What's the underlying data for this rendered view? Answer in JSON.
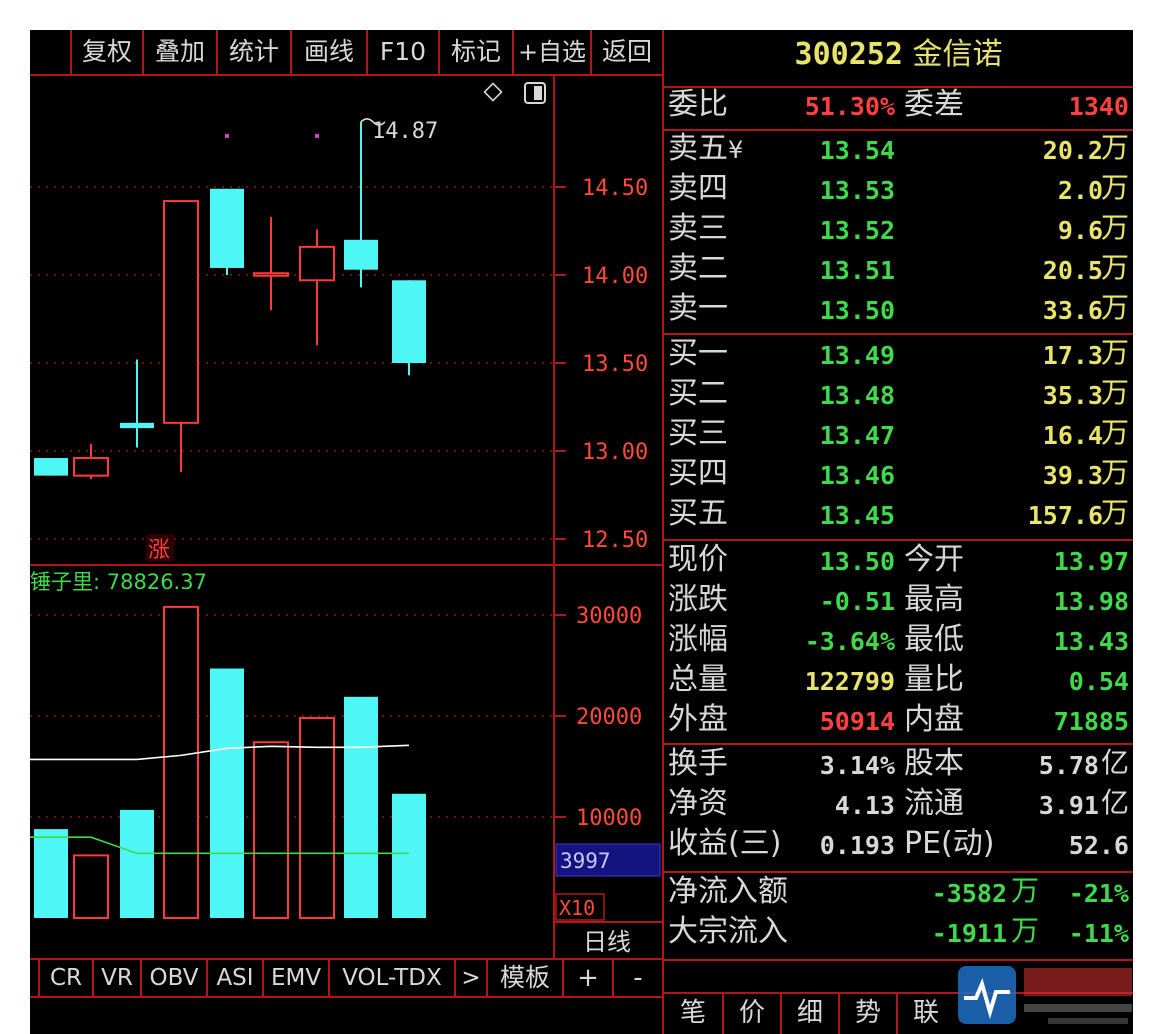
{
  "toolbar": {
    "buttons": [
      "复权",
      "叠加",
      "统计",
      "画线",
      "F10",
      "标记",
      "+自选",
      "返回"
    ]
  },
  "stock": {
    "code": "300252",
    "name": "金信诺"
  },
  "weibi": {
    "label": "委比",
    "value": "51.30%",
    "diff_label": "委差",
    "diff_value": "1340"
  },
  "sell_orders": [
    {
      "label": "卖五",
      "mark": "¥",
      "price": "13.54",
      "volume": "20.2",
      "unit": "万"
    },
    {
      "label": "卖四",
      "mark": "",
      "price": "13.53",
      "volume": "2.0",
      "unit": "万"
    },
    {
      "label": "卖三",
      "mark": "",
      "price": "13.52",
      "volume": "9.6",
      "unit": "万"
    },
    {
      "label": "卖二",
      "mark": "",
      "price": "13.51",
      "volume": "20.5",
      "unit": "万"
    },
    {
      "label": "卖一",
      "mark": "",
      "price": "13.50",
      "volume": "33.6",
      "unit": "万"
    }
  ],
  "buy_orders": [
    {
      "label": "买一",
      "price": "13.49",
      "volume": "17.3",
      "unit": "万"
    },
    {
      "label": "买二",
      "price": "13.48",
      "volume": "35.3",
      "unit": "万"
    },
    {
      "label": "买三",
      "price": "13.47",
      "volume": "16.4",
      "unit": "万"
    },
    {
      "label": "买四",
      "price": "13.46",
      "volume": "39.3",
      "unit": "万"
    },
    {
      "label": "买五",
      "price": "13.45",
      "volume": "157.6",
      "unit": "万"
    }
  ],
  "quote": [
    {
      "l1": "现价",
      "v1": "13.50",
      "c1": "#3fd94a",
      "l2": "今开",
      "v2": "13.97",
      "c2": "#3fd94a"
    },
    {
      "l1": "涨跌",
      "v1": "-0.51",
      "c1": "#3fd94a",
      "l2": "最高",
      "v2": "13.98",
      "c2": "#3fd94a"
    },
    {
      "l1": "涨幅",
      "v1": "-3.64%",
      "c1": "#3fd94a",
      "l2": "最低",
      "v2": "13.43",
      "c2": "#3fd94a"
    },
    {
      "l1": "总量",
      "v1": "122799",
      "c1": "#e9e36a",
      "l2": "量比",
      "v2": "0.54",
      "c2": "#3fd94a"
    },
    {
      "l1": "外盘",
      "v1": "50914",
      "c1": "#ff4040",
      "l2": "内盘",
      "v2": "71885",
      "c2": "#3fd94a"
    }
  ],
  "fundamentals": [
    {
      "l1": "换手",
      "v1": "3.14%",
      "l2": "股本",
      "v2": "5.78",
      "u2": "亿"
    },
    {
      "l1": "净资",
      "v1": "4.13",
      "l2": "流通",
      "v2": "3.91",
      "u2": "亿"
    },
    {
      "l1": "收益(三)",
      "v1": "0.193",
      "l2": "PE(动)",
      "v2": "52.6",
      "u2": ""
    }
  ],
  "flows": [
    {
      "label": "净流入额",
      "amount": "-3582",
      "unit": "万",
      "pct": "-21%"
    },
    {
      "label": "大宗流入",
      "amount": "-1911",
      "unit": "万",
      "pct": "-11%"
    }
  ],
  "bottom_tabs": [
    "笔",
    "价",
    "细",
    "势",
    "联"
  ],
  "indicator_tabs": [
    "CR",
    "VR",
    "OBV",
    "ASI",
    "EMV",
    "VOL-TDX",
    ">",
    "模板",
    "+",
    "-"
  ],
  "chart_labels": {
    "high_marker": "14.87",
    "zhang_badge": "涨",
    "volume_label": "锤子里: 78826.37",
    "cursor_value": "3997",
    "multiplier": "X10",
    "period": "日线"
  },
  "colors": {
    "up": "#ff3a3a",
    "down": "#4ff6f6",
    "border": "#b01818",
    "ma_white": "#ffffff",
    "ma_green": "#3fd94a"
  },
  "chart_data": [
    {
      "type": "candlestick",
      "y_ticks": [
        "14.50",
        "14.00",
        "13.50",
        "13.00",
        "12.50"
      ],
      "ylim": [
        12.5,
        14.5
      ],
      "candles": [
        {
          "open": 12.96,
          "close": 12.86,
          "high": 12.96,
          "low": 12.86
        },
        {
          "open": 12.86,
          "close": 12.96,
          "high": 13.04,
          "low": 12.84
        },
        {
          "open": 13.16,
          "close": 13.13,
          "high": 13.52,
          "low": 13.02
        },
        {
          "open": 13.16,
          "close": 14.42,
          "high": 14.42,
          "low": 12.88
        },
        {
          "open": 14.49,
          "close": 14.04,
          "high": 14.49,
          "low": 14.0
        },
        {
          "open": 14.01,
          "close": 14.01,
          "high": 14.33,
          "low": 13.8
        },
        {
          "open": 13.97,
          "close": 14.16,
          "high": 14.26,
          "low": 13.6
        },
        {
          "open": 14.2,
          "close": 14.03,
          "high": 14.87,
          "low": 13.93
        },
        {
          "open": 13.97,
          "close": 13.5,
          "high": 13.97,
          "low": 13.43
        }
      ],
      "dots": [
        {
          "index": 4,
          "value": 14.79
        },
        {
          "index": 6,
          "value": 14.79
        }
      ]
    },
    {
      "type": "bar",
      "y_ticks": [
        "30000",
        "20000",
        "10000"
      ],
      "ylim": [
        0,
        30000
      ],
      "values": [
        8800,
        6200,
        10700,
        30800,
        24700,
        17400,
        19800,
        21900,
        12300
      ],
      "directions": [
        "down",
        "up",
        "down",
        "up",
        "down",
        "up",
        "up",
        "down",
        "down"
      ],
      "ma_white": [
        15700,
        15700,
        15700,
        16100,
        16800,
        17000,
        16900,
        16900,
        17100
      ],
      "ma_green": [
        8000,
        8000,
        6400,
        6400,
        6400,
        6400,
        6400,
        6400,
        6400
      ]
    }
  ]
}
